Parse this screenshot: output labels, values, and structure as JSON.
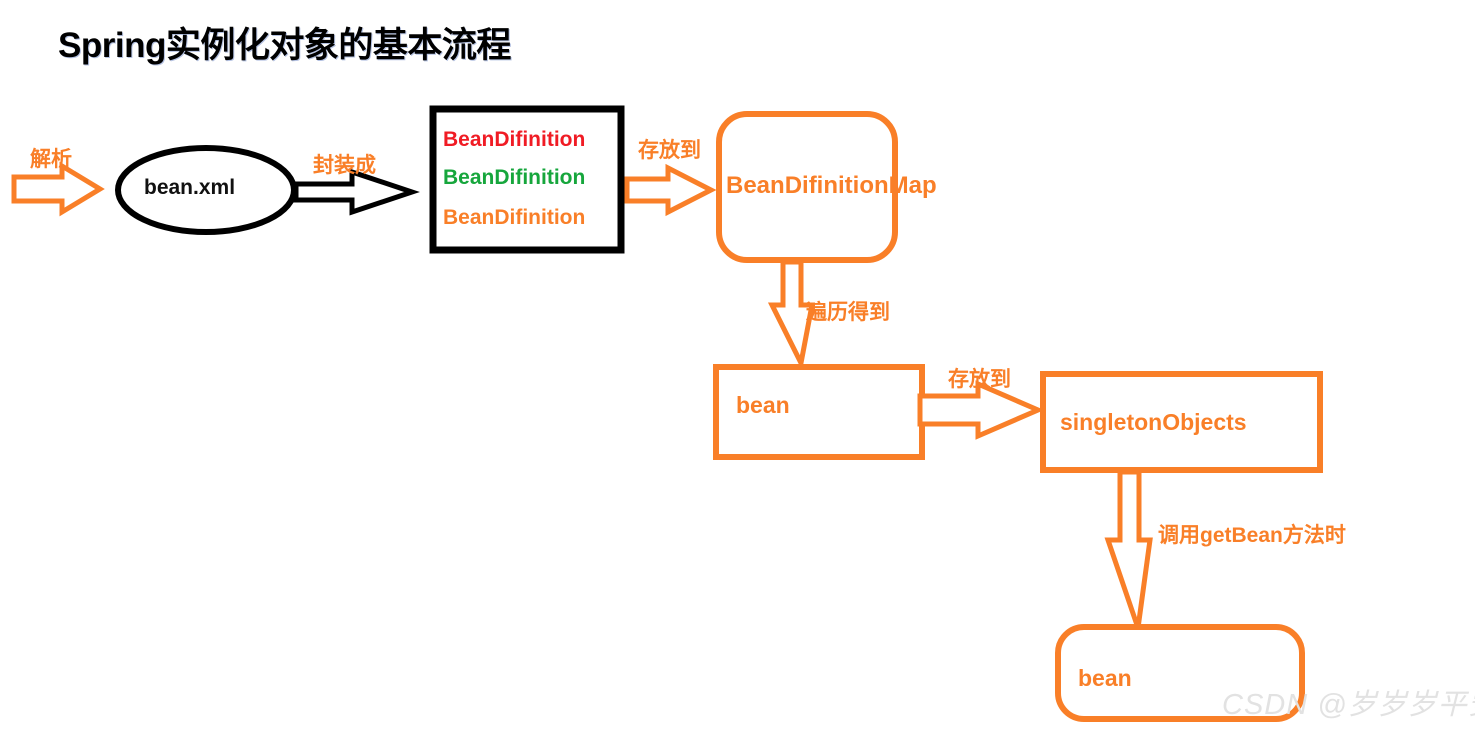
{
  "page": {
    "title": "Spring实例化对象的基本流程",
    "watermark": "CSDN @岁岁岁平安",
    "background": "#ffffff"
  },
  "colors": {
    "orange": "#F97F28",
    "black": "#000000",
    "red": "#F01B24",
    "green": "#16A63C",
    "watermark_gray": "#e2e2e2"
  },
  "nodes": {
    "bean_xml": {
      "label": "bean.xml",
      "shape": "ellipse",
      "stroke": "#000000"
    },
    "definition_list": {
      "shape": "rectangle",
      "stroke": "#000000",
      "items": [
        {
          "label": "BeanDifinition",
          "color": "#F01B24"
        },
        {
          "label": "BeanDifinition",
          "color": "#16A63C"
        },
        {
          "label": "BeanDifinition",
          "color": "#F97F28"
        }
      ]
    },
    "definition_map": {
      "label": "BeanDifinitionMap",
      "shape": "rounded-rectangle",
      "stroke": "#F97F28"
    },
    "bean_instance": {
      "label": "bean",
      "shape": "rectangle",
      "stroke": "#F97F28"
    },
    "singleton_objects": {
      "label": "singletonObjects",
      "shape": "rectangle",
      "stroke": "#F97F28"
    },
    "bean_result": {
      "label": "bean",
      "shape": "rounded-rectangle",
      "stroke": "#F97F28"
    }
  },
  "edges": [
    {
      "id": "parse",
      "label": "解析",
      "from": "",
      "to": "bean_xml",
      "color": "#F97F28",
      "direction": "right"
    },
    {
      "id": "wrap",
      "label": "封装成",
      "from": "bean_xml",
      "to": "definition_list",
      "color": "#000000",
      "direction": "right"
    },
    {
      "id": "store-map",
      "label": "存放到",
      "from": "definition_list",
      "to": "definition_map",
      "color": "#F97F28",
      "direction": "right"
    },
    {
      "id": "iterate",
      "label": "遍历得到",
      "from": "definition_map",
      "to": "bean_instance",
      "color": "#F97F28",
      "direction": "down"
    },
    {
      "id": "store-singleton",
      "label": "存放到",
      "from": "bean_instance",
      "to": "singleton_objects",
      "color": "#F97F28",
      "direction": "right"
    },
    {
      "id": "get-bean",
      "label": "调用getBean方法时",
      "from": "singleton_objects",
      "to": "bean_result",
      "color": "#F97F28",
      "direction": "down"
    }
  ]
}
